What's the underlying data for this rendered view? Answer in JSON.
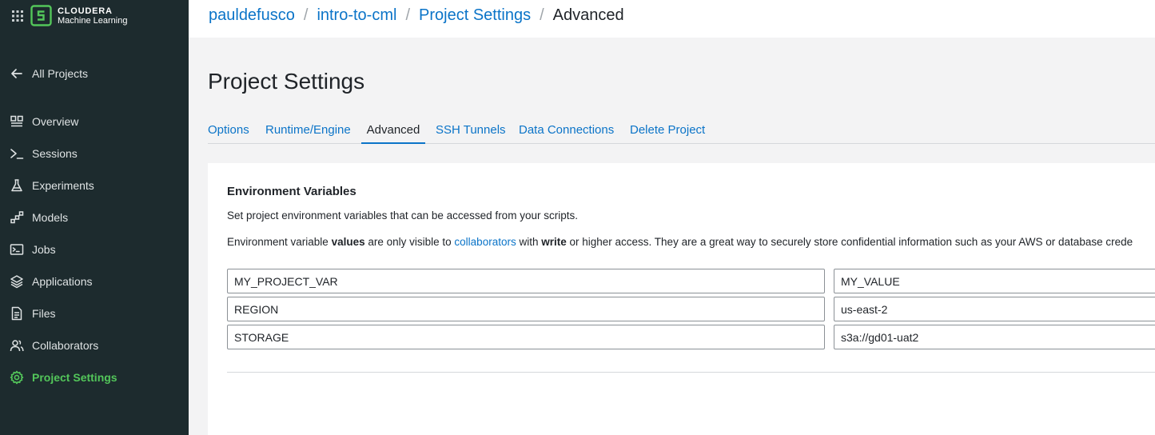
{
  "sidebar": {
    "logo": {
      "brand": "CLOUDERA",
      "product": "Machine Learning",
      "accent": "#53c65a"
    },
    "back_label": "All Projects",
    "items": [
      {
        "label": "Overview",
        "icon": "overview-icon"
      },
      {
        "label": "Sessions",
        "icon": "terminal-icon"
      },
      {
        "label": "Experiments",
        "icon": "flask-icon"
      },
      {
        "label": "Models",
        "icon": "models-icon"
      },
      {
        "label": "Jobs",
        "icon": "jobs-icon"
      },
      {
        "label": "Applications",
        "icon": "layers-icon"
      },
      {
        "label": "Files",
        "icon": "file-icon"
      },
      {
        "label": "Collaborators",
        "icon": "users-icon"
      },
      {
        "label": "Project Settings",
        "icon": "gear-icon",
        "active": true
      }
    ]
  },
  "breadcrumb": {
    "user": "pauldefusco",
    "project": "intro-to-cml",
    "settings": "Project Settings",
    "current": "Advanced",
    "separator": "/"
  },
  "page": {
    "title": "Project Settings"
  },
  "tabs": [
    {
      "label": "Options"
    },
    {
      "label": "Runtime/Engine"
    },
    {
      "label": "Advanced",
      "active": true
    },
    {
      "label": "SSH Tunnels"
    },
    {
      "label": "Data Connections"
    },
    {
      "label": "Delete Project"
    }
  ],
  "env": {
    "title": "Environment Variables",
    "description": "Set project environment variables that can be accessed from your scripts.",
    "note": {
      "p1": "Environment variable ",
      "b1": "values",
      "p2": " are only visible to ",
      "link": "collaborators",
      "p3": " with ",
      "b2": "write",
      "p4": " or higher access. They are a great way to securely store confidential information such as your AWS or database crede"
    },
    "variables": [
      {
        "key": "MY_PROJECT_VAR",
        "value": "MY_VALUE"
      },
      {
        "key": "REGION",
        "value": "us-east-2"
      },
      {
        "key": "STORAGE",
        "value": "s3a://gd01-uat2"
      }
    ]
  },
  "colors": {
    "sidebar_bg": "#1d2b2e",
    "link": "#0b74c8",
    "active_nav": "#53c65a"
  }
}
